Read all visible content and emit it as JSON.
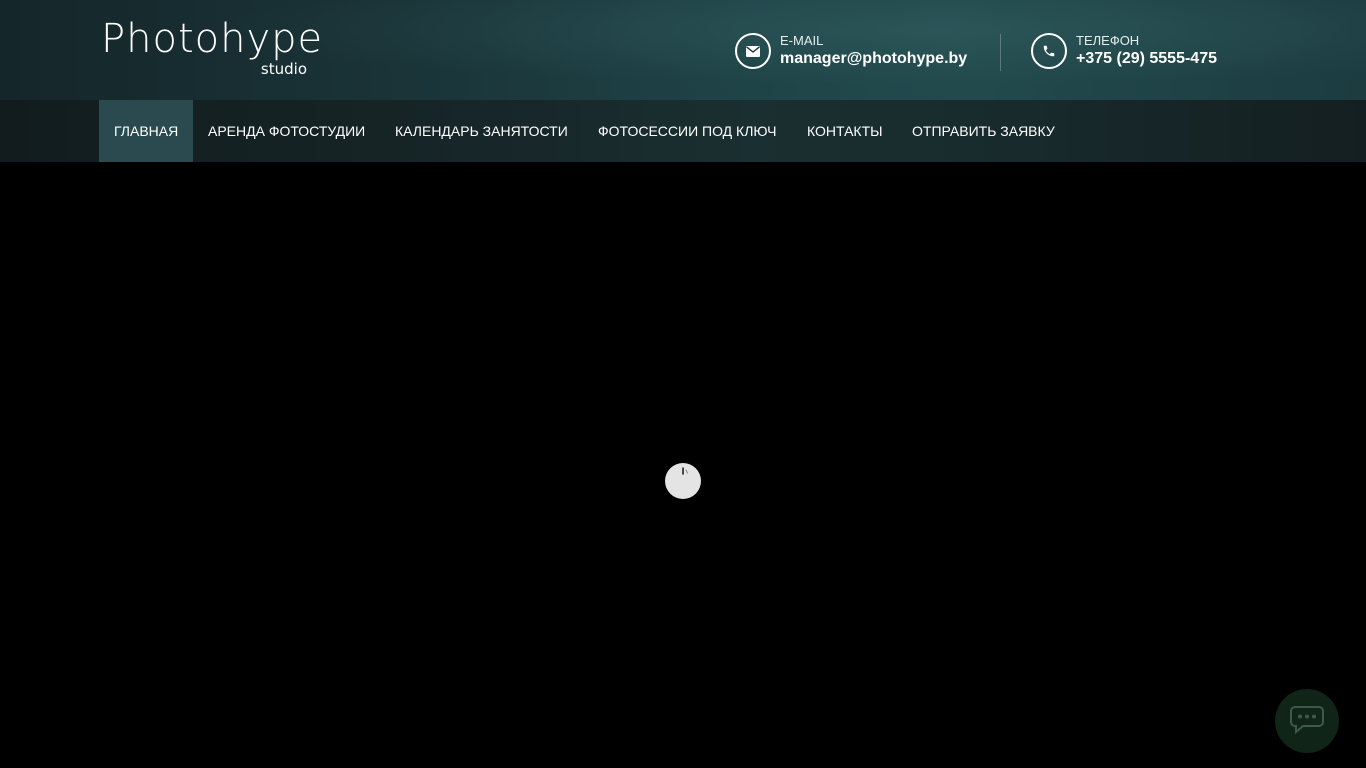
{
  "logo": {
    "main": "Photohype",
    "sub": "studio"
  },
  "contacts": {
    "email": {
      "icon": "envelope-icon",
      "label": "E-MAIL",
      "value": "manager@photohype.by"
    },
    "phone": {
      "icon": "phone-icon",
      "label": "ТЕЛЕФОН",
      "value": "+375 (29) 5555-475"
    }
  },
  "nav": {
    "items": [
      {
        "label": "ГЛАВНАЯ",
        "active": true
      },
      {
        "label": "АРЕНДА ФОТОСТУДИИ",
        "active": false
      },
      {
        "label": "КАЛЕНДАРЬ ЗАНЯТОСТИ",
        "active": false
      },
      {
        "label": "ФОТОСЕССИИ ПОД КЛЮЧ",
        "active": false
      },
      {
        "label": "КОНТАКТЫ",
        "active": false
      },
      {
        "label": "ОТПРАВИТЬ ЗАЯВКУ",
        "active": false
      }
    ]
  },
  "content": {
    "loader_icon": "spinner-icon"
  },
  "chat": {
    "icon": "chat-bubble-icon"
  },
  "colors": {
    "header_accent": "#224a4d",
    "nav_active": "#2a4a4f",
    "chat_button": "#102418"
  }
}
